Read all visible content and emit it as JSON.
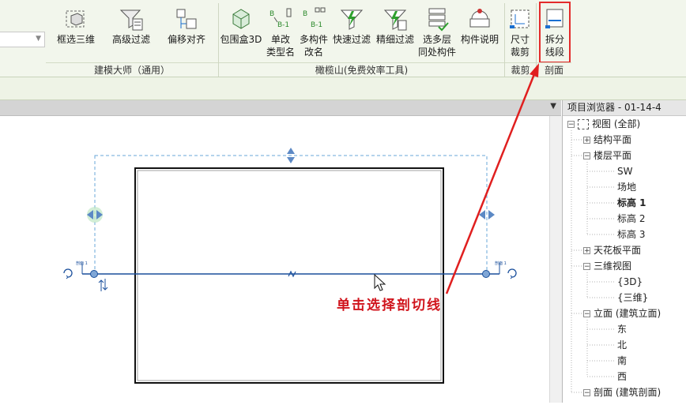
{
  "ribbon": {
    "tools": [
      {
        "id": "select-3d",
        "label": "框选三维",
        "icon": "box-select-icon"
      },
      {
        "id": "adv-filter",
        "label": "高级过滤",
        "icon": "filter-list-icon"
      },
      {
        "id": "offset-align",
        "label": "偏移对齐",
        "icon": "offset-align-icon"
      },
      {
        "id": "bbox-3d",
        "label": "包围盒3D",
        "icon": "bounding-box-3d-icon"
      },
      {
        "id": "rename-type",
        "label": "单改\n类型名",
        "icon": "rename-type-icon"
      },
      {
        "id": "rename-multi",
        "label": "多构件\n改名",
        "icon": "rename-multi-icon"
      },
      {
        "id": "quick-filter",
        "label": "快速过滤",
        "icon": "quick-filter-icon"
      },
      {
        "id": "fine-filter",
        "label": "精细过滤",
        "icon": "fine-filter-icon"
      },
      {
        "id": "multi-level",
        "label": "选多层\n同处构件",
        "icon": "multi-level-icon"
      },
      {
        "id": "component-desc",
        "label": "构件说明",
        "icon": "component-desc-icon"
      },
      {
        "id": "size-crop",
        "label": "尺寸\n裁剪",
        "icon": "size-crop-icon"
      },
      {
        "id": "split-segment",
        "label": "拆分\n线段",
        "icon": "split-segment-icon"
      }
    ],
    "groups": {
      "g1": "建模大师（通用）",
      "g2": "橄榄山(免费效率工具)",
      "g3": "裁剪",
      "g4": "剖面"
    }
  },
  "browser": {
    "title": "项目浏览器 - 01-14-4",
    "items": [
      {
        "label": "视图 (全部)",
        "toggle": "−",
        "level": 0
      },
      {
        "label": "结构平面",
        "toggle": "+",
        "level": 1
      },
      {
        "label": "楼层平面",
        "toggle": "−",
        "level": 1
      },
      {
        "label": "SW",
        "level": 2
      },
      {
        "label": "场地",
        "level": 2
      },
      {
        "label": "标高 1",
        "level": 2,
        "bold": true
      },
      {
        "label": "标高 2",
        "level": 2
      },
      {
        "label": "标高 3",
        "level": 2
      },
      {
        "label": "天花板平面",
        "toggle": "+",
        "level": 1
      },
      {
        "label": "三维视图",
        "toggle": "−",
        "level": 1
      },
      {
        "label": "{3D}",
        "level": 2
      },
      {
        "label": "{三维}",
        "level": 2
      },
      {
        "label": "立面 (建筑立面)",
        "toggle": "−",
        "level": 1
      },
      {
        "label": "东",
        "level": 2
      },
      {
        "label": "北",
        "level": 2
      },
      {
        "label": "南",
        "level": 2
      },
      {
        "label": "西",
        "level": 2
      },
      {
        "label": "剖面 (建筑剖面)",
        "toggle": "−",
        "level": 1
      }
    ]
  },
  "canvas": {
    "section_tag_left": "剖面 1",
    "section_tag_right": "剖面 1",
    "annotation": "单击选择剖切线"
  },
  "colors": {
    "highlight": "#e32b2b",
    "section_line": "#1a4f9c",
    "annotation": "#d0141c"
  }
}
